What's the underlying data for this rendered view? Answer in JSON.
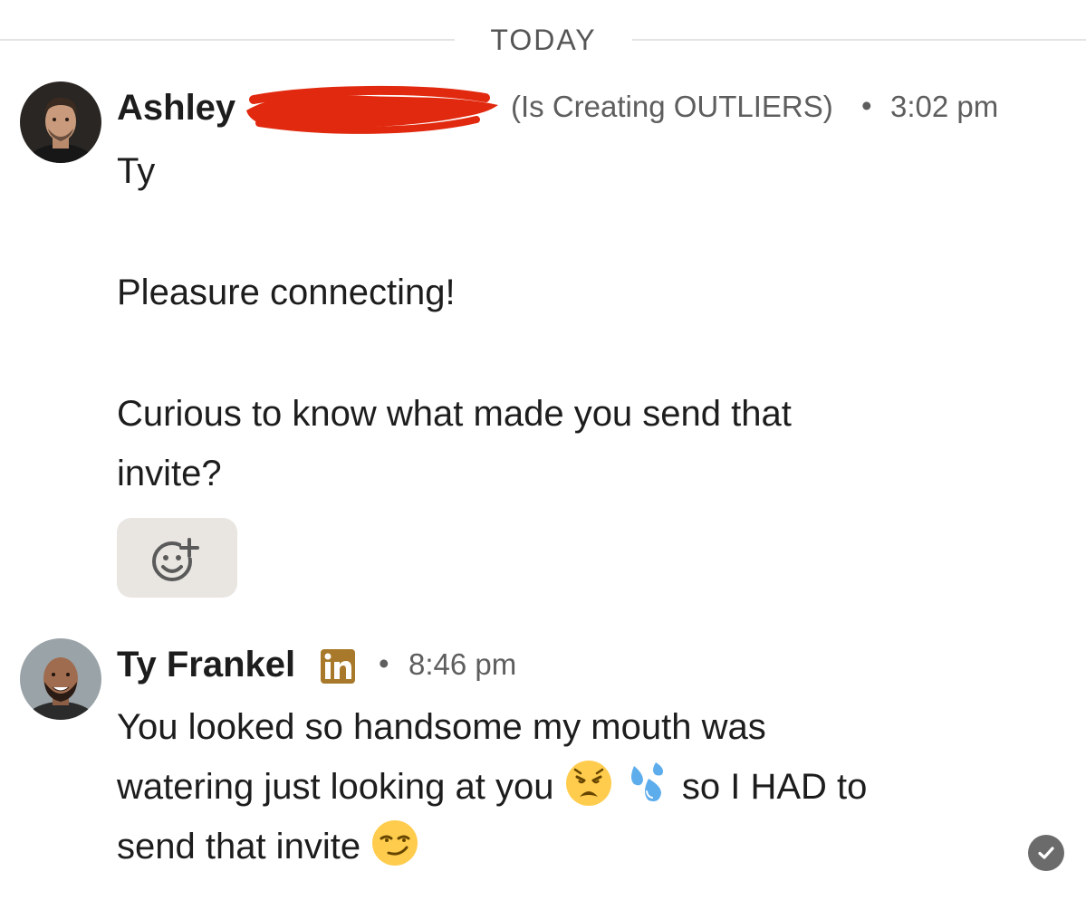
{
  "date_divider": {
    "label": "TODAY"
  },
  "messages": [
    {
      "sender": "Ashley",
      "headline": "(Is Creating OUTLIERS)",
      "separator": "•",
      "time": "3:02 pm",
      "lines": [
        "Ty",
        "Pleasure connecting!",
        "Curious to know what made you send that",
        "invite?"
      ],
      "reaction_button_icon": "add-reaction-icon"
    },
    {
      "sender": "Ty Frankel",
      "badge": "linkedin-premium-badge",
      "separator": "•",
      "time": "8:46 pm",
      "line1": "You looked so handsome my mouth was",
      "line2_before": "watering just looking at you",
      "line2_after": "so I HAD to",
      "line3": "send that invite",
      "emojis": [
        "weary-face-emoji",
        "sweat-droplets-emoji",
        "smirking-face-emoji"
      ],
      "status_icon": "read-check-icon"
    }
  ],
  "colors": {
    "badge_gold": "#a8792a",
    "redaction": "#e1290f",
    "reaction_bg": "#e9e6e2",
    "text": "#1d1d1d",
    "meta": "#5e5e5e"
  }
}
